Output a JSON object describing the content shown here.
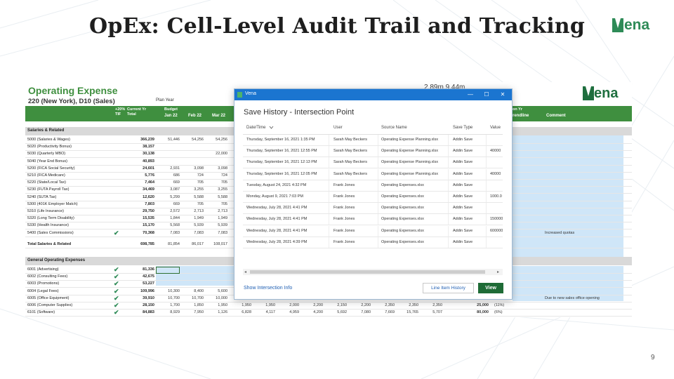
{
  "slide": {
    "title": "OpEx: Cell-Level Audit Trail and Tracking",
    "logo_text": "ena",
    "page_number": "9"
  },
  "sheet": {
    "title": "Operating Expense",
    "subtitle": "220 (New York), D10 (Sales)",
    "plan_year": "Plan Year",
    "top_numbers": "2.89m   9.44m",
    "logo_text": "ena",
    "headers": {
      "pct": "+20%\nTIF",
      "current_yr": "Current Yr\nTotal",
      "budget": "Budget",
      "jan": "Jan 22",
      "feb": "Feb 22",
      "mar": "Mar 22",
      "prior_yr": "on Yr",
      "trendline": "rendline",
      "comment": "Comment"
    },
    "sections": [
      {
        "label": "Salaries & Related"
      },
      {
        "label": "General Operating Expenses"
      }
    ],
    "salary_rows": [
      {
        "label": "5000 (Salaries & Wages)",
        "total": "366,239",
        "jan": "51,446",
        "feb": "54,256",
        "mar": "54,256",
        "check": false,
        "comment": ""
      },
      {
        "label": "5020 (Productivity Bonus)",
        "total": "38,157",
        "jan": "",
        "feb": "",
        "mar": "",
        "check": false,
        "comment": ""
      },
      {
        "label": "5030 (Quarterly MBO)",
        "total": "30,138",
        "jan": "",
        "feb": "",
        "mar": "22,000",
        "check": false,
        "comment": ""
      },
      {
        "label": "5040 (Year End Bonus)",
        "total": "40,893",
        "jan": "",
        "feb": "",
        "mar": "",
        "check": false,
        "comment": ""
      },
      {
        "label": "5200 (FICA Social Security)",
        "total": "24,601",
        "jan": "2,931",
        "feb": "3,098",
        "mar": "3,098",
        "check": false,
        "comment": ""
      },
      {
        "label": "5210 (FICA Medicare)",
        "total": "5,776",
        "jan": "686",
        "feb": "724",
        "mar": "724",
        "check": false,
        "comment": ""
      },
      {
        "label": "5220 (State/Local Tax)",
        "total": "7,464",
        "jan": "669",
        "feb": "705",
        "mar": "705",
        "check": false,
        "comment": ""
      },
      {
        "label": "5230 (FUTA Payroll Tax)",
        "total": "34,469",
        "jan": "3,087",
        "feb": "3,255",
        "mar": "3,255",
        "check": false,
        "comment": ""
      },
      {
        "label": "5240 (SUTA Tax)",
        "total": "12,620",
        "jan": "5,299",
        "feb": "5,588",
        "mar": "5,588",
        "check": false,
        "comment": ""
      },
      {
        "label": "5300 (401K Employer Match)",
        "total": "7,803",
        "jan": "669",
        "feb": "705",
        "mar": "705",
        "check": false,
        "comment": ""
      },
      {
        "label": "5310 (Life Insurance)",
        "total": "29,750",
        "jan": "2,572",
        "feb": "2,713",
        "mar": "2,713",
        "check": false,
        "comment": ""
      },
      {
        "label": "5320 (Long Term Disability)",
        "total": "15,535",
        "jan": "1,844",
        "feb": "1,949",
        "mar": "1,949",
        "check": false,
        "comment": ""
      },
      {
        "label": "5330 (Health Insurance)",
        "total": "15,170",
        "jan": "5,568",
        "feb": "5,939",
        "mar": "5,939",
        "check": false,
        "comment": ""
      },
      {
        "label": "5400 (Sales Commissions)",
        "total": "70,368",
        "jan": "7,083",
        "feb": "7,083",
        "mar": "7,083",
        "check": true,
        "comment": "Increased quotas"
      }
    ],
    "total_row": {
      "label": "Total Salaries & Related",
      "total": "698,785",
      "jan": "81,854",
      "feb": "86,017",
      "mar": "108,017"
    },
    "opex_rows": [
      {
        "label": "6001 (Advertising)",
        "total": "81,336",
        "check": true,
        "cells": [],
        "extra": "",
        "comment": ""
      },
      {
        "label": "6002 (Consulting Fees)",
        "total": "42,675",
        "check": true,
        "cells": [],
        "extra": "",
        "comment": ""
      },
      {
        "label": "6003 (Promotions)",
        "total": "53,227",
        "check": true,
        "cells": [],
        "extra": "",
        "comment": ""
      },
      {
        "label": "6004 (Legal Fees)",
        "total": "109,996",
        "check": true,
        "cells": [
          "10,300",
          "8,400",
          "5,600"
        ],
        "extra": "",
        "comment": ""
      },
      {
        "label": "6005 (Office Equipment)",
        "total": "39,910",
        "check": true,
        "cells": [
          "10,700",
          "10,700",
          "10,000"
        ],
        "extra": "",
        "comment": "Due to new sales office opening"
      },
      {
        "label": "6006 (Computer Supplies)",
        "total": "28,150",
        "check": true,
        "cells": [
          "1,700",
          "1,850",
          "1,950",
          "1,950",
          "1,950",
          "2,000",
          "2,200",
          "2,150",
          "2,200",
          "2,350",
          "2,350",
          "2,350",
          "25,000"
        ],
        "extra": "(11%)",
        "comment": ""
      },
      {
        "label": "6101 (Software)",
        "total": "84,883",
        "check": true,
        "cells": [
          "8,929",
          "7,950",
          "1,126",
          "6,828",
          "4,117",
          "4,959",
          "4,200",
          "5,692",
          "7,080",
          "7,669",
          "15,765",
          "5,707",
          "80,000"
        ],
        "extra": "(6%)",
        "comment": ""
      }
    ]
  },
  "dialog": {
    "app_title": "Vena",
    "controls": {
      "minimize": "—",
      "maximize": "☐",
      "close": "✕"
    },
    "heading": "Save History - Intersection Point",
    "columns": [
      "Date/Time",
      "User",
      "Source Name",
      "Save Type",
      "Value"
    ],
    "rows": [
      {
        "datetime": "Thursday, September 16, 2021 1:35 PM",
        "user": "Sarah May Beckers",
        "source": "Operating Expense Planning.xlsx",
        "type": "Addin Save",
        "value": ""
      },
      {
        "datetime": "Thursday, September 16, 2021 12:55 PM",
        "user": "Sarah May Beckers",
        "source": "Operating Expense Planning.xlsx",
        "type": "Addin Save",
        "value": "40000"
      },
      {
        "datetime": "Thursday, September 16, 2021 12:13 PM",
        "user": "Sarah May Beckers",
        "source": "Operating Expense Planning.xlsx",
        "type": "Addin Save",
        "value": ""
      },
      {
        "datetime": "Thursday, September 16, 2021 12:05 PM",
        "user": "Sarah May Beckers",
        "source": "Operating Expense Planning.xlsx",
        "type": "Addin Save",
        "value": "40000"
      },
      {
        "datetime": "Tuesday, August 24, 2021 4:32 PM",
        "user": "Frank Jones",
        "source": "Operating Expenses.xlsx",
        "type": "Addin Save",
        "value": ""
      },
      {
        "datetime": "Monday, August 9, 2021 7:03 PM",
        "user": "Frank Jones",
        "source": "Operating Expenses.xlsx",
        "type": "Addin Save",
        "value": "1000.0"
      },
      {
        "datetime": "Wednesday, July 28, 2021 4:41 PM",
        "user": "Frank Jones",
        "source": "Operating Expenses.xlsx",
        "type": "Addin Save",
        "value": ""
      },
      {
        "datetime": "Wednesday, July 28, 2021 4:41 PM",
        "user": "Frank Jones",
        "source": "Operating Expenses.xlsx",
        "type": "Addin Save",
        "value": "150000"
      },
      {
        "datetime": "Wednesday, July 28, 2021 4:41 PM",
        "user": "Frank Jones",
        "source": "Operating Expenses.xlsx",
        "type": "Addin Save",
        "value": "600000"
      },
      {
        "datetime": "Wednesday, July 28, 2021 4:39 PM",
        "user": "Frank Jones",
        "source": "Operating Expenses.xlsx",
        "type": "Addin Save",
        "value": ""
      }
    ],
    "show_link": "Show Intersection Info",
    "history_button": "Line Item History",
    "view_button": "View"
  },
  "colors": {
    "brand_green": "#2e8b57",
    "header_green": "#3f8f3f",
    "titlebar_blue": "#1b75d0",
    "input_blue": "#cfe6f8",
    "view_button": "#1e6b36"
  }
}
